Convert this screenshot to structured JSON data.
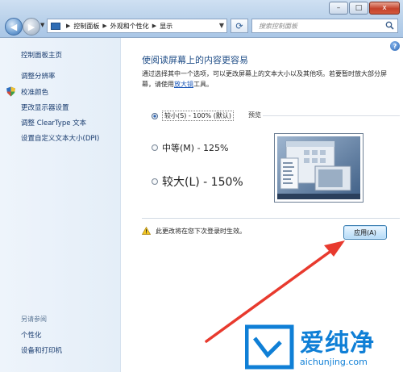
{
  "window": {
    "minimize": "–",
    "maximize": "□",
    "close": "x"
  },
  "nav": {
    "back": "◀",
    "forward": "▶"
  },
  "address": {
    "crumbs": [
      "控制面板",
      "外观和个性化",
      "显示"
    ],
    "separator": "▶",
    "dropdown": "▼"
  },
  "refresh": "⟳",
  "search": {
    "placeholder": "搜索控制面板"
  },
  "sidebar": {
    "home": "控制面板主页",
    "items": [
      "调整分辨率",
      "校准颜色",
      "更改显示器设置",
      "调整 ClearType 文本",
      "设置自定义文本大小(DPI)"
    ],
    "see_also": "另请参阅",
    "see_also_items": [
      "个性化",
      "设备和打印机"
    ]
  },
  "main": {
    "help": "?",
    "heading": "使阅读屏幕上的内容更容易",
    "description_before": "通过选择其中一个选项，可以更改屏幕上的文本大小以及其他项。若要暂时放大部分屏幕，请使用",
    "magnifier_link": "放大镜",
    "description_after": "工具。",
    "options": [
      {
        "label": "较小(S) - 100% (默认)",
        "selected": true
      },
      {
        "label": "中等(M) - 125%",
        "selected": false
      },
      {
        "label": "较大(L) - 150%",
        "selected": false
      }
    ],
    "preview_label": "预览",
    "notice": "此更改将在您下次登录时生效。",
    "apply_button": "应用(A)"
  },
  "watermark": {
    "brand": "爱纯净",
    "url": "aichunjing.com"
  },
  "colors": {
    "annotation_arrow": "#e83a2e",
    "watermark": "#0f7fd6",
    "link": "#173a6d"
  }
}
